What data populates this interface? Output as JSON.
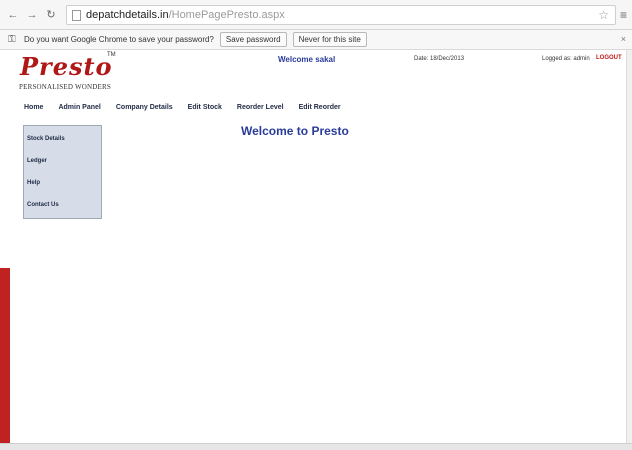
{
  "browser": {
    "url_host": "depatchdetails.in",
    "url_path": "/HomePagePresto.aspx",
    "infobar": {
      "message": "Do you want Google Chrome to save your password?",
      "save_label": "Save password",
      "never_label": "Never for this site"
    }
  },
  "header": {
    "logo": "Presto",
    "tm": "TM",
    "tagline": "PERSONALISED WONDERS",
    "welcome_user": "Welcome sakal",
    "date": "Date: 18/Dec/2013",
    "logged_in": "Logged as: admin",
    "logout": "LOGOUT"
  },
  "menu": [
    "Home",
    "Admin Panel",
    "Company Details",
    "Edit Stock",
    "Reorder Level",
    "Edit Reorder"
  ],
  "sidebar": [
    "Stock Details",
    "Ledger",
    "Help",
    "Contact Us"
  ],
  "main": {
    "title": "Welcome to Presto"
  },
  "colors": {
    "brand_red": "#b01818",
    "title_blue": "#2a3c9a",
    "sidebar_bg": "#d6dde8"
  }
}
